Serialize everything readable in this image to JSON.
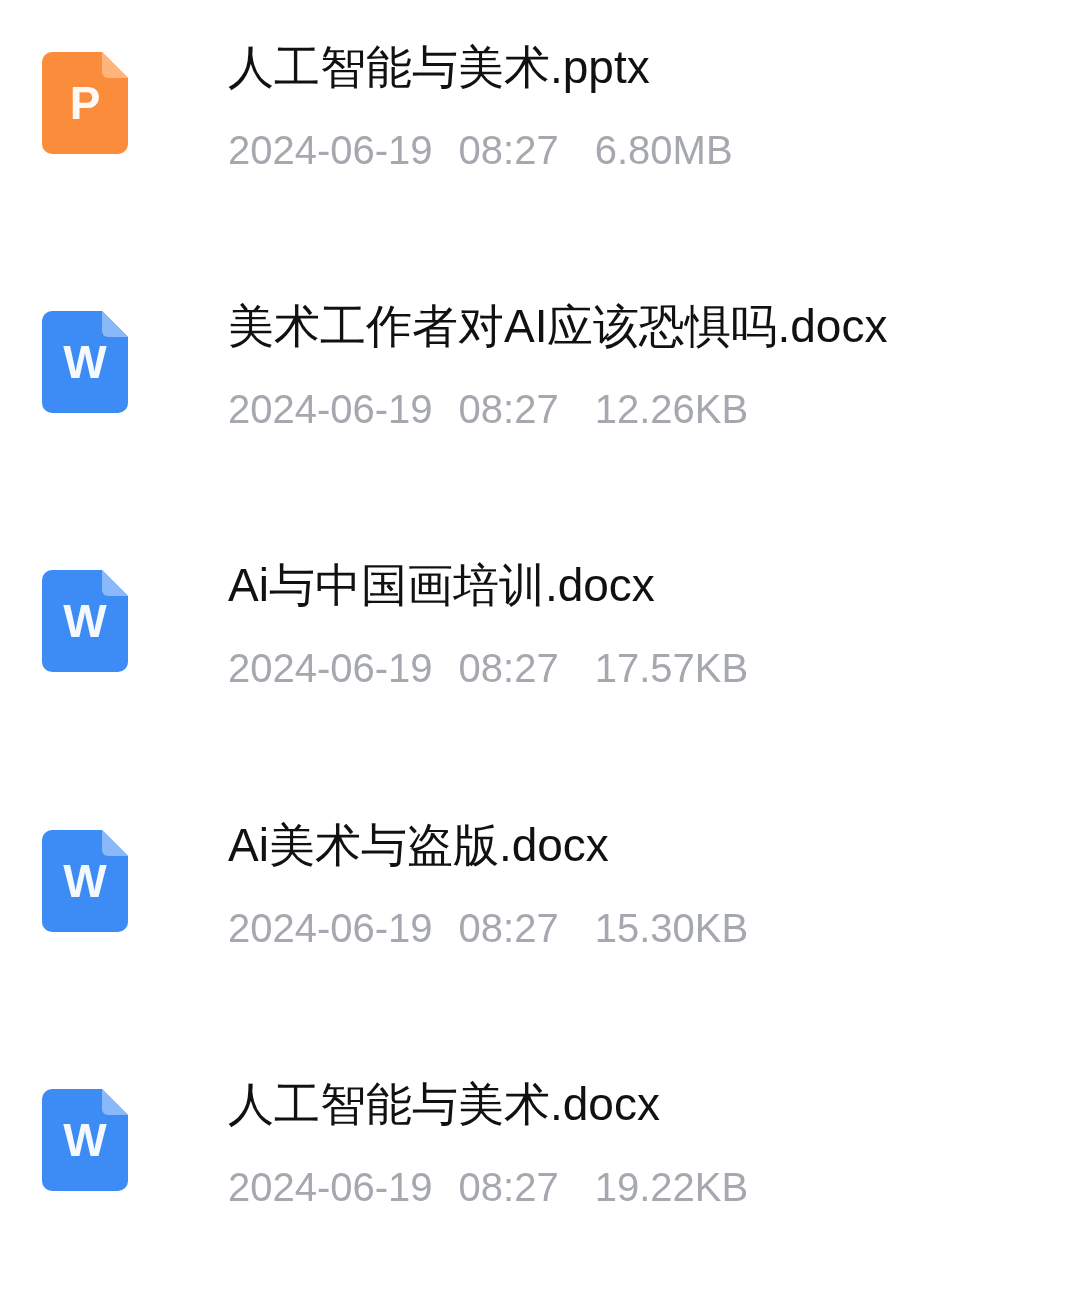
{
  "files": [
    {
      "kind": "pptx",
      "icon_letter": "P",
      "name": "人工智能与美术.pptx",
      "date": "2024-06-19",
      "time": "08:27",
      "size": "6.80MB"
    },
    {
      "kind": "docx",
      "icon_letter": "W",
      "name": "美术工作者对AI应该恐惧吗.docx",
      "date": "2024-06-19",
      "time": "08:27",
      "size": "12.26KB"
    },
    {
      "kind": "docx",
      "icon_letter": "W",
      "name": "Ai与中国画培训.docx",
      "date": "2024-06-19",
      "time": "08:27",
      "size": "17.57KB"
    },
    {
      "kind": "docx",
      "icon_letter": "W",
      "name": "Ai美术与盗版.docx",
      "date": "2024-06-19",
      "time": "08:27",
      "size": "15.30KB"
    },
    {
      "kind": "docx",
      "icon_letter": "W",
      "name": "人工智能与美术.docx",
      "date": "2024-06-19",
      "time": "08:27",
      "size": "19.22KB"
    }
  ]
}
